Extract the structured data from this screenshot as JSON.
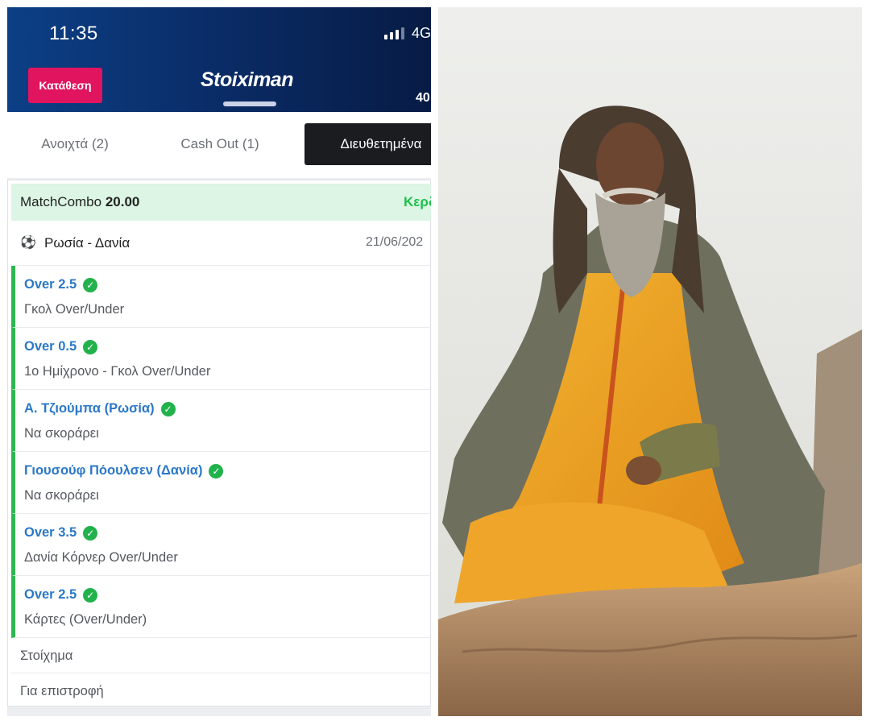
{
  "status_bar": {
    "time": "11:35",
    "network": "4G"
  },
  "header": {
    "deposit_label": "Κατάθεση",
    "logo_text": "Stoiximan",
    "balance": "40"
  },
  "tabs": [
    {
      "label": "Ανοιχτά (2)",
      "active": false
    },
    {
      "label": "Cash Out (1)",
      "active": false
    },
    {
      "label": "Διευθετημένα",
      "active": true
    }
  ],
  "bet": {
    "type": "MatchCombo",
    "odds": "20.00",
    "status": "Κερδ",
    "match": {
      "teams": "Ρωσία - Δανία",
      "date": "21/06/202"
    },
    "selections": [
      {
        "pick": "Over 2.5",
        "market": "Γκολ Over/Under"
      },
      {
        "pick": "Over 0.5",
        "market": "1ο Ημίχρονο - Γκολ Over/Under"
      },
      {
        "pick": "Α. Τζιούμπα (Ρωσία)",
        "market": "Να σκοράρει"
      },
      {
        "pick": "Γιουσούφ Πόουλσεν (Δανία)",
        "market": "Να σκοράρει"
      },
      {
        "pick": "Over 3.5",
        "market": "Δανία Κόρνερ Over/Under"
      },
      {
        "pick": "Over 2.5",
        "market": "Κάρτες (Over/Under)"
      }
    ],
    "stake_label": "Στοίχημα",
    "return_label": "Για επιστροφή"
  },
  "colors": {
    "header_bg": "#0a2a63",
    "deposit": "#e0145f",
    "win_green": "#1fbf4c",
    "pick_blue": "#2a78c8",
    "card_head_bg": "#dcf5e4"
  },
  "icons": {
    "ball": "football-icon",
    "check": "check-circle-icon",
    "signal": "signal-bars-icon"
  }
}
